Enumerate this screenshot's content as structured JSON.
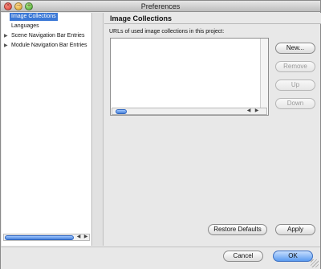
{
  "window": {
    "title": "Preferences",
    "controls": {
      "close": "×",
      "minimize": "–",
      "maximize": "+"
    }
  },
  "sidebar": {
    "items": [
      {
        "label": "Image Collections",
        "selected": true,
        "expandable": false
      },
      {
        "label": "Languages",
        "selected": false,
        "expandable": false
      },
      {
        "label": "Scene Navigation Bar Entries",
        "selected": false,
        "expandable": true
      },
      {
        "label": "Module Navigation Bar Entries",
        "selected": false,
        "expandable": true
      }
    ],
    "scroll": {
      "left": "◀",
      "right": "▶"
    }
  },
  "panel": {
    "title": "Image Collections",
    "section_label": "URLs of used image collections in this project:",
    "list_scroll": {
      "left": "◀",
      "right": "▶"
    }
  },
  "buttons": {
    "new": "New...",
    "remove": "Remove",
    "up": "Up",
    "down": "Down",
    "restore_defaults": "Restore Defaults",
    "apply": "Apply",
    "cancel": "Cancel",
    "ok": "OK"
  },
  "icons": {
    "expand_arrow": "▶"
  },
  "colors": {
    "selection": "#3b78d6",
    "primary_button": "#5b9bf0",
    "scroll_thumb": "#4a82d8"
  }
}
